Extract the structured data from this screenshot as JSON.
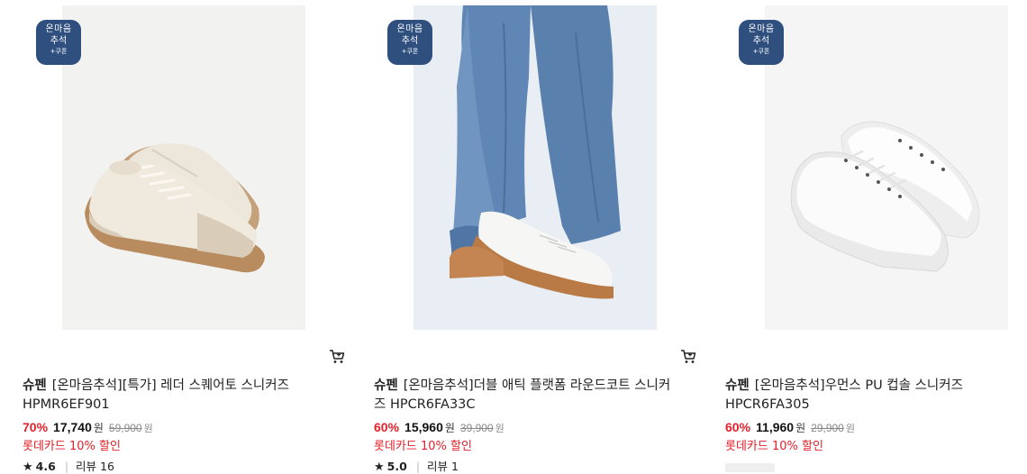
{
  "badge": {
    "line1": "온마음",
    "line2": "추석",
    "line3": "+쿠폰"
  },
  "products": [
    {
      "brand": "슈펜",
      "name_line1": "[온마음추석][특가] 레더 스퀘어토 스니커즈",
      "name_line2": "HPMR6EF901",
      "discount": "70%",
      "price": "17,740",
      "currency": "원",
      "original_price": "59,900",
      "card_discount": "롯데카드 10% 할인",
      "rating": "4.6",
      "review_label": "리뷰 16"
    },
    {
      "brand": "슈펜",
      "name_line1": "[온마음추석]더블 애틱 플랫폼 라운드코트 스니커",
      "name_line2": "즈 HPCR6FA33C",
      "discount": "60%",
      "price": "15,960",
      "currency": "원",
      "original_price": "39,900",
      "card_discount": "롯데카드 10% 할인",
      "rating": "5.0",
      "review_label": "리뷰 1"
    },
    {
      "brand": "슈펜",
      "name_line1": "[온마음추석]우먼스 PU 컵솔 스니커즈",
      "name_line2": "HPCR6FA305",
      "discount": "60%",
      "price": "11,960",
      "currency": "원",
      "original_price": "29,900",
      "card_discount": "롯데카드 10% 할인"
    }
  ],
  "icons": {
    "cart": "cart-icon",
    "star": "star-icon"
  }
}
